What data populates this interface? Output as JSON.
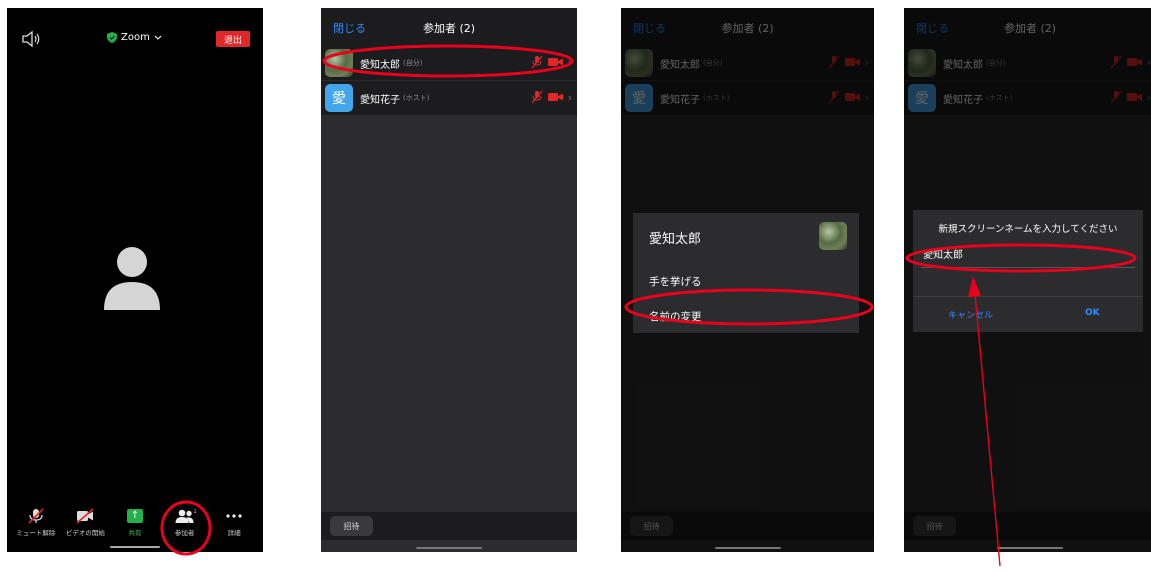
{
  "meeting": {
    "title": "Zoom",
    "leave_label": "退出",
    "toolbar": [
      {
        "label": "ミュート解除",
        "icon": "muted-mic-icon"
      },
      {
        "label": "ビデオの開始",
        "icon": "video-off-icon"
      },
      {
        "label": "共有",
        "icon": "share-icon"
      },
      {
        "label": "参加者",
        "icon": "participants-icon",
        "badge": "2"
      },
      {
        "label": "詳細",
        "icon": "more-icon"
      }
    ]
  },
  "participants": {
    "close_label": "閉じる",
    "title": "参加者 (2)",
    "invite_label": "招待",
    "rows": [
      {
        "name": "愛知太郎",
        "tag": "(自分)",
        "avatar": "photo"
      },
      {
        "name": "愛知花子",
        "tag": "(ホスト)",
        "avatar": "愛"
      }
    ]
  },
  "action_sheet": {
    "name": "愛知太郎",
    "items": [
      "手を挙げる",
      "名前の変更"
    ]
  },
  "rename_dialog": {
    "title": "新規スクリーンネームを入力してください",
    "value": "愛知太郎",
    "cancel_label": "キャンセル",
    "ok_label": "OK"
  },
  "colors": {
    "accent_blue": "#2d8cff",
    "danger_red": "#e02828",
    "annotation_red": "#e8001c",
    "share_green": "#22b14c"
  }
}
